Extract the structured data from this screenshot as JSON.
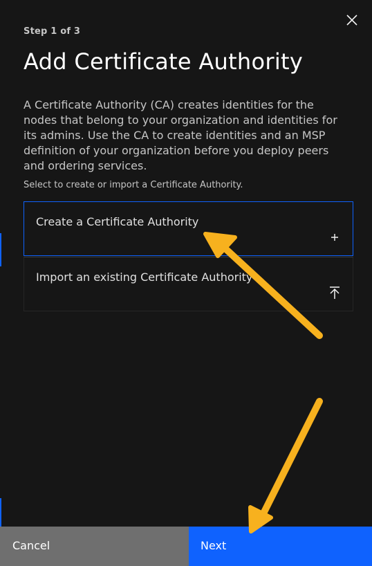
{
  "step": "Step 1 of 3",
  "title": "Add Certificate Authority",
  "description": "A Certificate Authority (CA) creates identities for the nodes that belong to your organization and identities for its admins. Use the CA to create identities and an MSP definition of your organization before you deploy peers and ordering services.",
  "select_label": "Select to create or import a Certificate Authority.",
  "options": [
    {
      "label": "Create a Certificate Authority",
      "icon": "plus-icon",
      "selected": true
    },
    {
      "label": "Import an existing Certificate Authority",
      "icon": "upload-icon",
      "selected": false
    }
  ],
  "buttons": {
    "cancel": "Cancel",
    "next": "Next"
  },
  "colors": {
    "background": "#161616",
    "accent": "#0f62fe",
    "cancel": "#6f6f6f",
    "annotation_arrow": "#f7b11e"
  }
}
